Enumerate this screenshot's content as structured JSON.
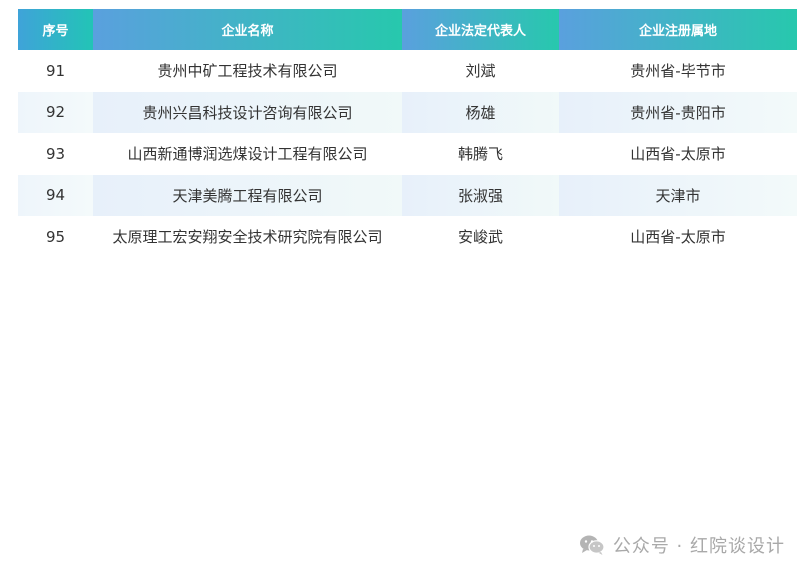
{
  "table": {
    "headers": [
      "序号",
      "企业名称",
      "企业法定代表人",
      "企业注册属地"
    ],
    "rows": [
      {
        "seq": "91",
        "name": "贵州中矿工程技术有限公司",
        "rep": "刘斌",
        "loc": "贵州省-毕节市"
      },
      {
        "seq": "92",
        "name": "贵州兴昌科技设计咨询有限公司",
        "rep": "杨雄",
        "loc": "贵州省-贵阳市"
      },
      {
        "seq": "93",
        "name": "山西新通博润选煤设计工程有限公司",
        "rep": "韩腾飞",
        "loc": "山西省-太原市"
      },
      {
        "seq": "94",
        "name": "天津美腾工程有限公司",
        "rep": "张淑强",
        "loc": "天津市"
      },
      {
        "seq": "95",
        "name": "太原理工宏安翔安全技术研究院有限公司",
        "rep": "安峻武",
        "loc": "山西省-太原市"
      }
    ]
  },
  "watermark": {
    "icon": "wechat-icon",
    "text": "公众号 · 红院谈设计"
  },
  "colors": {
    "header_start": "#5aa0de",
    "header_end": "#27c8ad",
    "stripe": "#eef5fb",
    "text": "#333333",
    "watermark": "#a9a9a9"
  }
}
